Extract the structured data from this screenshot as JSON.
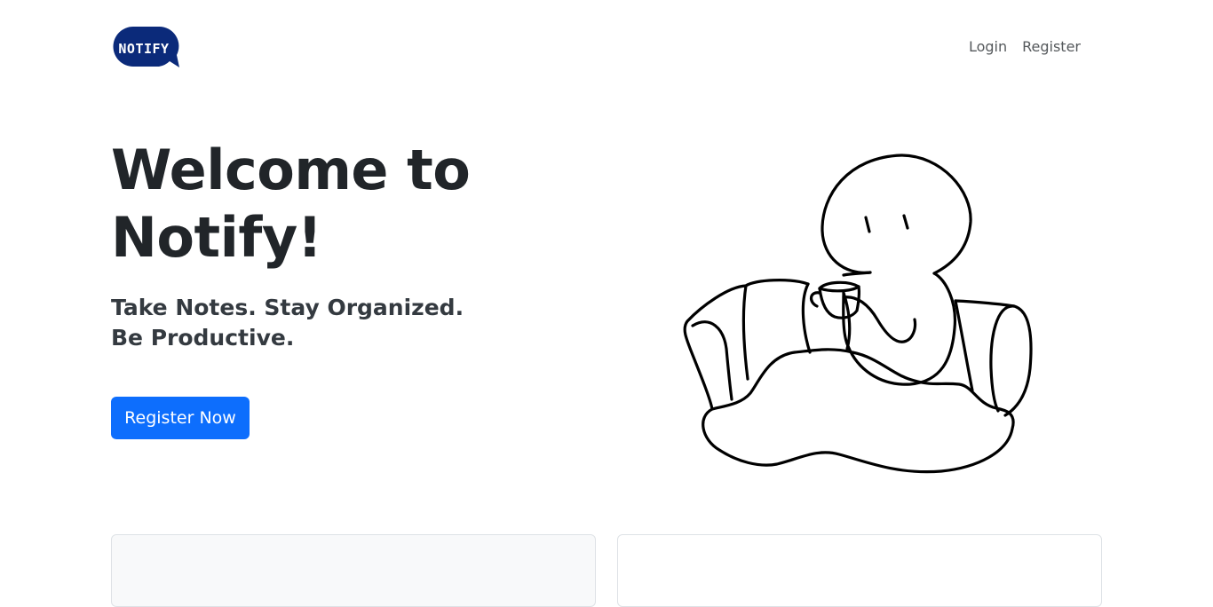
{
  "brand": {
    "logo_text": "NOTIFY",
    "logo_color": "#0b2a7a"
  },
  "nav": {
    "login_label": "Login",
    "register_label": "Register"
  },
  "hero": {
    "title": "Welcome to Notify!",
    "subtitle": "Take Notes. Stay Organized. Be Productive.",
    "cta_label": "Register Now",
    "accent_color": "#0d6efd"
  },
  "illustration": {
    "icon": "person-on-couch-with-cup-illustration"
  }
}
